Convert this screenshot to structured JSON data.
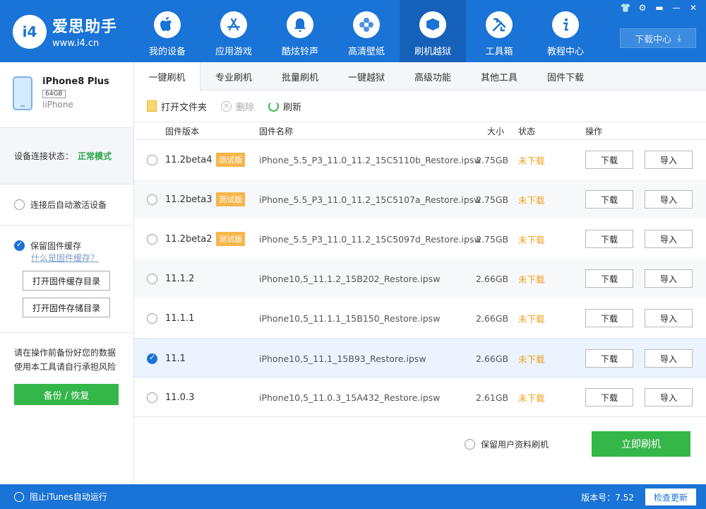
{
  "app": {
    "logo_badge": "i4",
    "name": "爱思助手",
    "url": "www.i4.cn"
  },
  "nav": [
    {
      "label": "我的设备",
      "icon": "apple-icon"
    },
    {
      "label": "应用游戏",
      "icon": "app-store-icon"
    },
    {
      "label": "酷炫铃声",
      "icon": "bell-icon"
    },
    {
      "label": "高清壁纸",
      "icon": "flower-icon"
    },
    {
      "label": "刷机越狱",
      "icon": "box-icon"
    },
    {
      "label": "工具箱",
      "icon": "tools-icon"
    },
    {
      "label": "教程中心",
      "icon": "info-icon"
    }
  ],
  "nav_active_index": 4,
  "window_controls": [
    "👕",
    "⚙",
    "▬",
    "—",
    "✕"
  ],
  "download_center": "下载中心",
  "device": {
    "name": "iPhone8 Plus",
    "capacity": "64GB",
    "type": "iiPhone"
  },
  "sidebar": {
    "connection_label": "设备连接状态：",
    "connection_mode": "正常模式",
    "auto_activate": "连接后自动激活设备",
    "keep_cache": "保留固件缓存",
    "what_is_cache": "什么是固件缓存？",
    "open_cache_dir": "打开固件缓存目录",
    "open_storage_dir": "打开固件存储目录",
    "backup_tip_1": "请在操作前备份好您的数据",
    "backup_tip_2": "使用本工具请自行承担风险",
    "backup_button": "备份 / 恢复"
  },
  "tabs": [
    "一键刷机",
    "专业刷机",
    "批量刷机",
    "一键越狱",
    "高级功能",
    "其他工具",
    "固件下载"
  ],
  "toolbar": {
    "open_folder": "打开文件夹",
    "delete": "删除",
    "refresh": "刷新"
  },
  "table": {
    "headers": {
      "version": "固件版本",
      "name": "固件名称",
      "size": "大小",
      "state": "状态",
      "action": "操作"
    },
    "rows": [
      {
        "version": "11.2beta4",
        "badge": "测试版",
        "name": "iPhone_5.5_P3_11.0_11.2_15C5110b_Restore.ipsw",
        "size": "2.75GB",
        "state": "未下载",
        "download": "下载",
        "import": "导入",
        "selected": false
      },
      {
        "version": "11.2beta3",
        "badge": "测试版",
        "name": "iPhone_5.5_P3_11.0_11.2_15C5107a_Restore.ipsw",
        "size": "2.75GB",
        "state": "未下载",
        "download": "下载",
        "import": "导入",
        "selected": false
      },
      {
        "version": "11.2beta2",
        "badge": "测试版",
        "name": "iPhone_5.5_P3_11.0_11.2_15C5097d_Restore.ipsw",
        "size": "2.75GB",
        "state": "未下载",
        "download": "下载",
        "import": "导入",
        "selected": false
      },
      {
        "version": "11.1.2",
        "badge": "",
        "name": "iPhone10,5_11.1.2_15B202_Restore.ipsw",
        "size": "2.66GB",
        "state": "未下载",
        "download": "下载",
        "import": "导入",
        "selected": false
      },
      {
        "version": "11.1.1",
        "badge": "",
        "name": "iPhone10,5_11.1.1_15B150_Restore.ipsw",
        "size": "2.66GB",
        "state": "未下载",
        "download": "下载",
        "import": "导入",
        "selected": false
      },
      {
        "version": "11.1",
        "badge": "",
        "name": "iPhone10,5_11.1_15B93_Restore.ipsw",
        "size": "2.66GB",
        "state": "未下载",
        "download": "下载",
        "import": "导入",
        "selected": true
      },
      {
        "version": "11.0.3",
        "badge": "",
        "name": "iPhone10,5_11.0.3_15A432_Restore.ipsw",
        "size": "2.61GB",
        "state": "未下载",
        "download": "下载",
        "import": "导入",
        "selected": false
      }
    ]
  },
  "footer": {
    "keep_user_data": "保留用户资料刷机",
    "flash_now": "立即刷机"
  },
  "statusbar": {
    "block_itunes": "阻止iTunes自动运行",
    "version": "版本号：7.52",
    "check_update": "检查更新"
  },
  "colors": {
    "brand_blue": "#1a73d6",
    "green": "#35b649",
    "state_orange": "#f0a11b",
    "badge_orange": "#f7b64a"
  }
}
